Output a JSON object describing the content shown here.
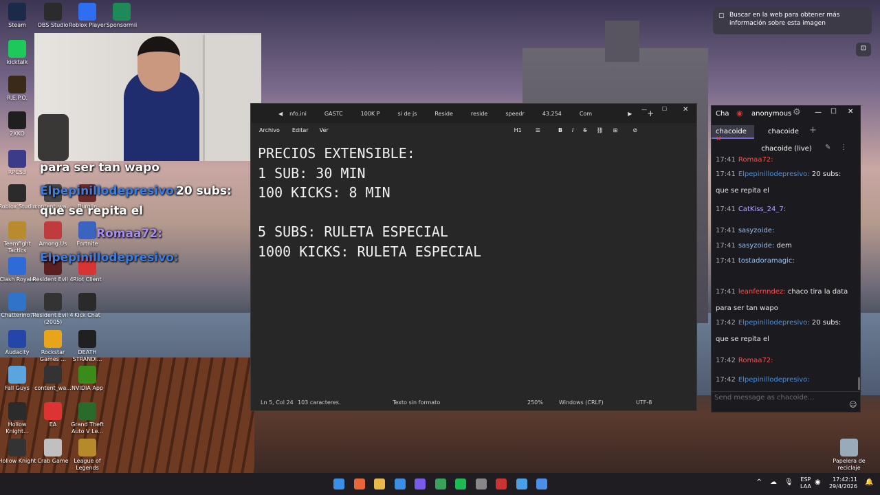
{
  "desktop_icons": [
    {
      "label": "Steam",
      "color": "#1b2a4a"
    },
    {
      "label": "OBS Studio",
      "color": "#2b2b2b"
    },
    {
      "label": "Roblox Player",
      "color": "#2e6ff2"
    },
    {
      "label": "Sponsormii",
      "color": "#1e8a57"
    },
    {
      "label": "kicktalk",
      "color": "#1dc95a"
    },
    {
      "label": "R.E.P.O.",
      "color": "#3a2a18"
    },
    {
      "label": "2XKO",
      "color": "#1f1f1f"
    },
    {
      "label": "RPCS3",
      "color": "#3b3b8a"
    },
    {
      "label": "Roblox Studio",
      "color": "#2b2b2b"
    },
    {
      "label": "content_wa...",
      "color": "#444"
    },
    {
      "label": "Burglin",
      "color": "#6a2b2b"
    },
    {
      "label": "Teamfight Tactics",
      "color": "#b88b2e"
    },
    {
      "label": "Among Us",
      "color": "#c03b3b"
    },
    {
      "label": "Fortnite",
      "color": "#3b64c0"
    },
    {
      "label": "Clash Royale",
      "color": "#2e6ad8"
    },
    {
      "label": "Resident Evil 4",
      "color": "#5a1f1f"
    },
    {
      "label": "Riot Client",
      "color": "#d93434"
    },
    {
      "label": "Chatterino7",
      "color": "#2f74c9"
    },
    {
      "label": "Resident Evil 4 (2005)",
      "color": "#333"
    },
    {
      "label": "Kick Chat",
      "color": "#2a2a2a"
    },
    {
      "label": "Audacity",
      "color": "#2546a8"
    },
    {
      "label": "Rockstar Games ...",
      "color": "#e8a51a"
    },
    {
      "label": "DEATH STRANDI...",
      "color": "#202020"
    },
    {
      "label": "Fall Guys",
      "color": "#5aa5e0"
    },
    {
      "label": "content_wa...",
      "color": "#333"
    },
    {
      "label": "NVIDIA App",
      "color": "#3a8c1a"
    },
    {
      "label": "Hollow Knight...",
      "color": "#2b2b2b"
    },
    {
      "label": "EA",
      "color": "#d33"
    },
    {
      "label": "Grand Theft Auto V Le...",
      "color": "#2a6a2a"
    },
    {
      "label": "Hollow Knight",
      "color": "#333"
    },
    {
      "label": "Crab Game",
      "color": "#c0c0c0"
    },
    {
      "label": "League of Legends",
      "color": "#b48a2a"
    },
    {
      "label": "Papelera de reciclaje",
      "color": "#9ab"
    }
  ],
  "overlay": {
    "line1": "para ser tan wapo",
    "user1": "Elpepinillodepresivo:",
    "line2": "20 subs:",
    "line3": "que se repita el",
    "user2": "Romaa72:",
    "user3": "Elpepinillodepresivo:"
  },
  "notepad": {
    "tabs": [
      "nfo.ini",
      "GASTC",
      "100K P",
      "si de js",
      "Reside",
      "reside",
      "speedr",
      "43.254",
      "Com"
    ],
    "menu": {
      "file": "Archivo",
      "edit": "Editar",
      "view": "Ver",
      "heading": "H1"
    },
    "lines": [
      "PRECIOS EXTENSIBLE:",
      "1 SUB: 30 MIN",
      "100 KICKS: 8 MIN",
      "",
      "5 SUBS: RULETA ESPECIAL",
      "1000 KICKS: RULETA ESPECIAL"
    ],
    "status": {
      "pos": "Ln 5, Col 24",
      "chars": "103 caracteres.",
      "format": "Texto sin formato",
      "zoom": "250%",
      "eol": "Windows (CRLF)",
      "enc": "UTF-8"
    }
  },
  "chat": {
    "title_short": "Cha",
    "title_user": "anonymous",
    "tabs": [
      "chacoide",
      "chacoide"
    ],
    "channel": "chacoide (live)",
    "messages": [
      {
        "time": "17:41",
        "user": "Romaa72:",
        "text": "",
        "ucls": "u4"
      },
      {
        "time": "17:41",
        "user": "Elpepinillodepresivo:",
        "text": "20 subs:",
        "ucls": "u1"
      },
      {
        "time": "",
        "user": "",
        "text": "que se repita el",
        "ucls": ""
      },
      {
        "time": "17:41",
        "user": "CatKiss_24_7:",
        "text": "",
        "ucls": "u2"
      },
      {
        "time": "17:41",
        "user": "sasyzoide:",
        "text": "",
        "ucls": "u3"
      },
      {
        "time": "17:41",
        "user": "sasyzoide:",
        "text": "dem",
        "ucls": "u3"
      },
      {
        "time": "17:41",
        "user": "tostadoramagic:",
        "text": "",
        "ucls": "u3"
      },
      {
        "time": "17:41",
        "user": "leanfernndez:",
        "text": "chaco tira la data",
        "ucls": "u4"
      },
      {
        "time": "",
        "user": "",
        "text": "para ser tan wapo",
        "ucls": ""
      },
      {
        "time": "17:42",
        "user": "Elpepinillodepresivo:",
        "text": "20 subs:",
        "ucls": "u1"
      },
      {
        "time": "",
        "user": "",
        "text": "que se repita el",
        "ucls": ""
      },
      {
        "time": "17:42",
        "user": "Romaa72:",
        "text": "",
        "ucls": "u4"
      },
      {
        "time": "17:42",
        "user": "Elpepinillodepresivo:",
        "text": "",
        "ucls": "u1"
      }
    ],
    "input_placeholder": "Send message as chacoide..."
  },
  "toast": "Buscar en la web para obtener más información sobre esta imagen",
  "tray": {
    "lang1": "ESP",
    "lang2": "LAA",
    "time": "17:42:11",
    "date": "29/4/2026"
  }
}
